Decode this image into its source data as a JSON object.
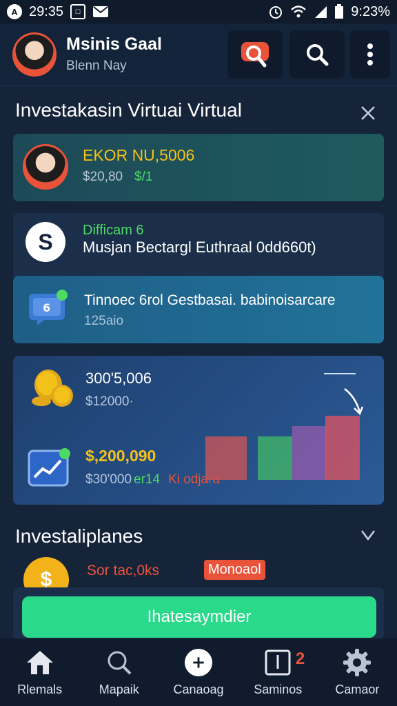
{
  "status_bar": {
    "time_left": "29:35",
    "time_right": "9:23%",
    "icons": [
      "app-icon",
      "notification-icon",
      "mail-icon",
      "alarm-icon",
      "wifi-icon",
      "signal-icon",
      "battery-icon"
    ]
  },
  "header": {
    "user_name": "Msinis Gaal",
    "user_sub": "Blenn Nay",
    "buttons": [
      "search-alert-icon",
      "search-icon",
      "more-vertical-icon"
    ]
  },
  "main": {
    "title": "Investakasin Virtuai Virtual",
    "card1": {
      "title": "EKOR NU,5006",
      "value1": "$20,80",
      "value2": "$/1"
    },
    "card2": {
      "logo_letter": "S",
      "title": "Difficam 6",
      "subtitle": "Musjan Bectargl Euthraal 0dd660t)"
    },
    "card3": {
      "title": "Tinnoec 6rol Gestbasai. babinoisarcare",
      "subtitle": "125aio"
    },
    "card4": {
      "value1": "300'5,006",
      "value2": "$12000·",
      "value3": "$,200,090",
      "value4": "$30'000",
      "value5": "er14",
      "value6": "Ki odjara",
      "bars": [
        {
          "color": "#c0555a",
          "value": 0.42
        },
        {
          "color": "#3fae6a",
          "value": 0.42
        },
        {
          "color": "#8a5aa8",
          "value": 0.52
        },
        {
          "color": "#cc5566",
          "value": 0.62
        }
      ]
    },
    "section2_title": "Investaliplanes",
    "row": {
      "coin_glyph": "$",
      "text": "Sor tac,0ks",
      "badge": "Monoaol"
    },
    "cta_label": "Ihatesaymdier"
  },
  "bottom_nav": {
    "items": [
      {
        "label": "Rlemals",
        "icon": "home-icon"
      },
      {
        "label": "Mapaik",
        "icon": "search-icon"
      },
      {
        "label": "Canaoag",
        "icon": "compass-icon"
      },
      {
        "label": "Saminos",
        "icon": "notice-icon",
        "badge": "2"
      },
      {
        "label": "Camaor",
        "icon": "gear-icon"
      }
    ]
  },
  "colors": {
    "accent_green": "#4cd964",
    "accent_yellow": "#f3c21a",
    "accent_orange": "#e8533a",
    "cta_green": "#2bd98a"
  }
}
